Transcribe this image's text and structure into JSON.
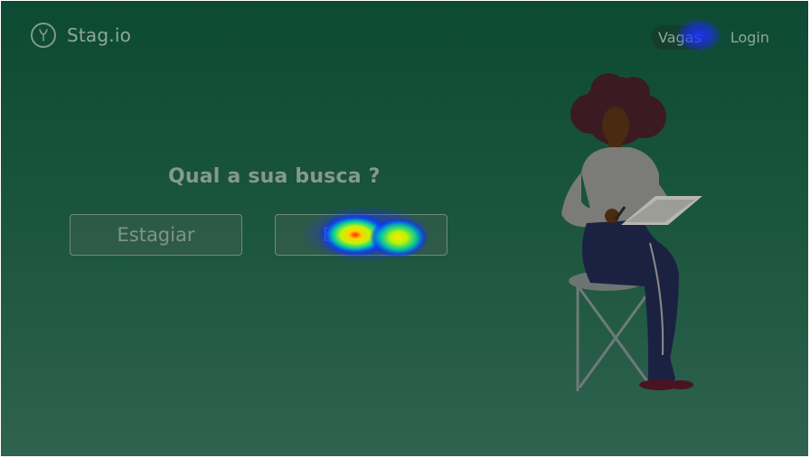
{
  "brand": {
    "name": "Stag.io",
    "logo_icon": "deer-icon"
  },
  "nav": {
    "items": [
      "Vagas",
      "Login"
    ],
    "active_index": 0
  },
  "main": {
    "question": "Qual a sua busca ?",
    "choices": [
      "Estagiar",
      "Estagiar"
    ]
  },
  "colors": {
    "accent": "#0d4a33",
    "overlay_text": "#8ea89a",
    "heatmap_hot": "#ff0000",
    "heatmap_warm": "#ffff00",
    "heatmap_cool": "#0000ff"
  }
}
